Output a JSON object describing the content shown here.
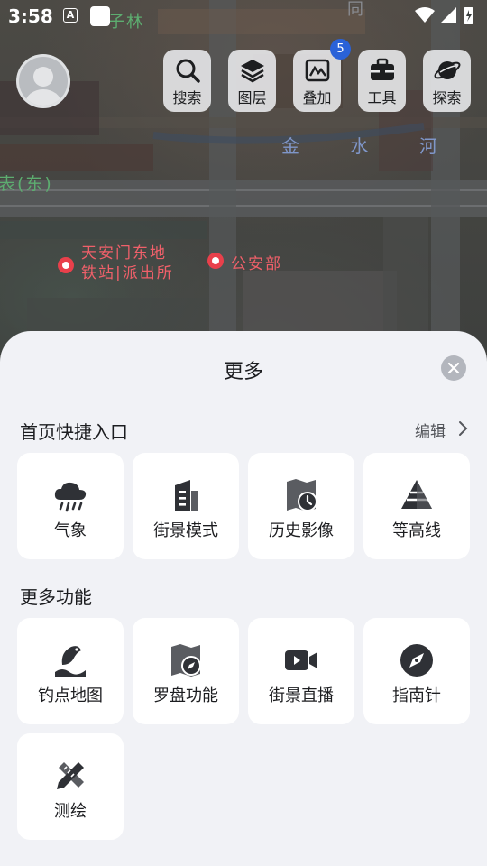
{
  "status_bar": {
    "time": "3:58",
    "notif_letter": "A"
  },
  "map": {
    "labels": {
      "river": "金 水 河",
      "district": "表(东)",
      "poi_station": "天安门东地铁站|派出所",
      "poi_ministry": "公安部",
      "top_green": "子林",
      "top_gray": "同"
    }
  },
  "toolbar": {
    "search": "搜索",
    "layers": "图层",
    "overlay": "叠加",
    "tools": "工具",
    "explore": "探索",
    "overlay_badge": "5"
  },
  "sheet": {
    "title": "更多",
    "shortcut_section": {
      "title": "首页快捷入口",
      "edit": "编辑",
      "items": [
        {
          "label": "气象",
          "icon": "weather-cloud-icon"
        },
        {
          "label": "街景模式",
          "icon": "building-icon"
        },
        {
          "label": "历史影像",
          "icon": "history-map-icon"
        },
        {
          "label": "等高线",
          "icon": "contour-cone-icon"
        }
      ]
    },
    "more_section": {
      "title": "更多功能",
      "items": [
        {
          "label": "钓点地图",
          "icon": "fishing-icon"
        },
        {
          "label": "罗盘功能",
          "icon": "compass-map-icon"
        },
        {
          "label": "街景直播",
          "icon": "video-camera-icon"
        },
        {
          "label": "指南针",
          "icon": "compass-icon"
        },
        {
          "label": "测绘",
          "icon": "survey-pencil-icon"
        }
      ]
    }
  }
}
